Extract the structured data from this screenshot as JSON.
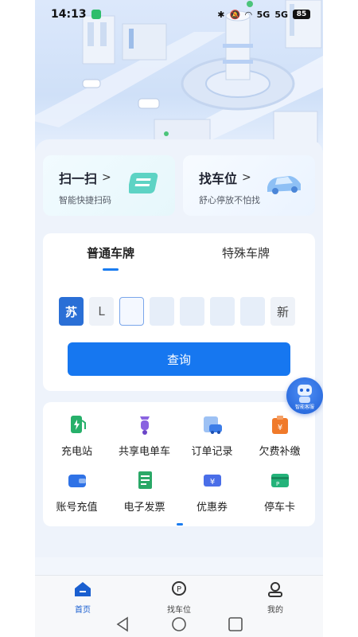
{
  "status_bar": {
    "time": "14:13",
    "signal_1": "5G",
    "signal_2": "5G",
    "battery": "85"
  },
  "quick_cards": [
    {
      "title": "扫一扫",
      "subtitle": "智能快捷扫码",
      "icon": "scan-icon"
    },
    {
      "title": "找车位",
      "subtitle": "舒心停放不怕找",
      "icon": "car-icon"
    }
  ],
  "plate": {
    "tabs": [
      {
        "label": "普通车牌",
        "active": true
      },
      {
        "label": "特殊车牌",
        "active": false
      }
    ],
    "province": "苏",
    "letter": "L",
    "new_energy_label": "新",
    "query_label": "查询"
  },
  "services": [
    {
      "label": "充电站",
      "icon": "charging-station-icon",
      "color": "#27b06a"
    },
    {
      "label": "共享电单车",
      "icon": "scooter-icon",
      "color": "#8a63e0"
    },
    {
      "label": "订单记录",
      "icon": "order-record-icon",
      "color": "#3c7de8"
    },
    {
      "label": "欠费补缴",
      "icon": "arrears-payment-icon",
      "color": "#f07a2a"
    },
    {
      "label": "账号充值",
      "icon": "wallet-icon",
      "color": "#2f72e6"
    },
    {
      "label": "电子发票",
      "icon": "invoice-icon",
      "color": "#2aa867"
    },
    {
      "label": "优惠券",
      "icon": "coupon-icon",
      "color": "#4a6ee8"
    },
    {
      "label": "停车卡",
      "icon": "parking-card-icon",
      "color": "#24b37a"
    }
  ],
  "assistant": {
    "label": "智能客服"
  },
  "bottom_nav": [
    {
      "label": "首页",
      "icon": "home-icon",
      "active": true
    },
    {
      "label": "找车位",
      "icon": "parking-pin-icon",
      "active": false
    },
    {
      "label": "我的",
      "icon": "profile-icon",
      "active": false
    }
  ],
  "colors": {
    "primary": "#1677f0",
    "province_plate": "#2a6fd6"
  }
}
